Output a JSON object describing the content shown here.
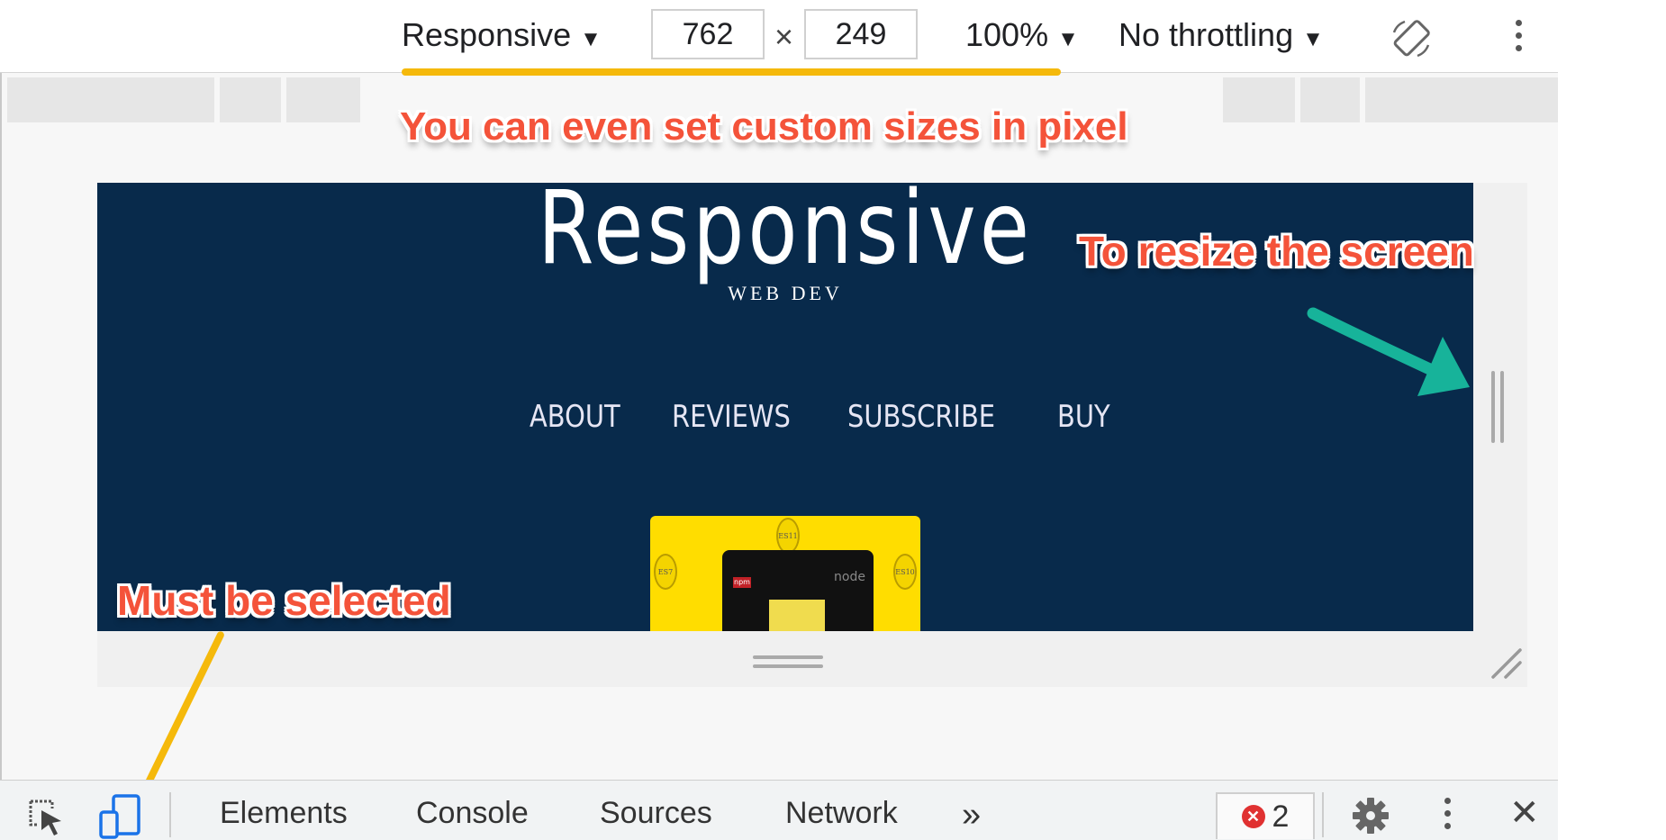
{
  "toolbar": {
    "device": "Responsive",
    "width": "762",
    "times": "×",
    "height": "249",
    "zoom": "100%",
    "throttling": "No throttling"
  },
  "site": {
    "title": "Responsive",
    "subtitle": "WEB DEV",
    "nav": [
      "ABOUT",
      "REVIEWS",
      "SUBSCRIBE",
      "BUY"
    ],
    "book_badges": [
      "ES11",
      "ES7",
      "ES10"
    ],
    "npm_label": "npm",
    "node_label": "node"
  },
  "annotations": {
    "custom_sizes": "You can even set custom sizes in pixel",
    "resize": "To resize the screen",
    "must_select": "Must be selected",
    "arrow_color": "#17b39a",
    "text_color": "#f4533a",
    "underline_color": "#f5b90b"
  },
  "bottombar": {
    "tabs": [
      "Elements",
      "Console",
      "Sources",
      "Network"
    ],
    "more": "»",
    "error_count": "2",
    "close": "✕"
  },
  "icons": [
    "inspect-icon",
    "device-toolbar-icon",
    "rotate-icon",
    "kebab-icon",
    "gear-icon",
    "close-icon"
  ]
}
